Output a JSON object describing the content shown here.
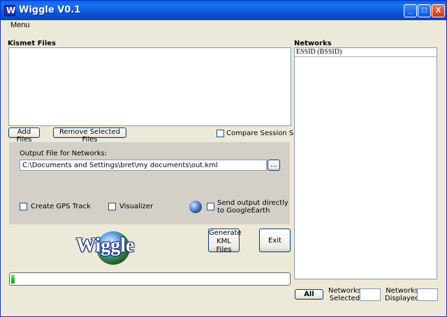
{
  "window": {
    "title": "Wiggle V0.1",
    "minimize": "_",
    "maximize": "□",
    "close": "X"
  },
  "menu": {
    "label": "Menu"
  },
  "kismet": {
    "label": "Kismet Files",
    "add_files": "Add Files",
    "remove_selected": "Remove Selected Files",
    "compare_sessions": "Compare Session Sets"
  },
  "output": {
    "label": "Output File for Networks:",
    "path": "C:\\Documents and Settings\\bret\\my documents\\out.kml",
    "browse": "...",
    "create_gps_track": "Create GPS Track",
    "visualizer": "Visualizer",
    "send_googleearth_line1": "Send output directly",
    "send_googleearth_line2": "to GoogleEarth"
  },
  "actions": {
    "generate_line1": "Generate",
    "generate_line2": "KML Files",
    "exit": "Exit"
  },
  "logo": {
    "text": "Wiggle"
  },
  "progress": {
    "fraction": 0.012
  },
  "networks": {
    "label": "Networks",
    "column_header": "ESSID  (BSSID)",
    "all_button": "All",
    "selected_line1": "Networks",
    "selected_line2": "Selected",
    "displayed_line1": "Networks",
    "displayed_line2": "Displayed"
  }
}
